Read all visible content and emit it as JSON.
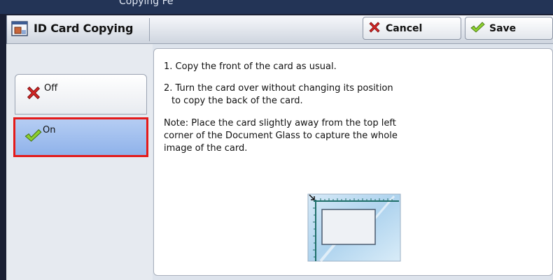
{
  "header_strip": {
    "text": "Copying Fe"
  },
  "window": {
    "title": "ID Card Copying",
    "cancel_label": "Cancel",
    "save_label": "Save"
  },
  "options": {
    "off_label": "Off",
    "on_label": "On",
    "selected": "On"
  },
  "instructions": {
    "step1": "1. Copy the front of the card as usual.",
    "step2_line1": "2. Turn the card over without changing its position",
    "step2_line2": "to copy the back of the card.",
    "note_line1": "Note: Place the card slightly away from the top left",
    "note_line2": "corner of the Document Glass to capture the whole",
    "note_line3": "image of the card."
  },
  "colors": {
    "selection_border": "#e41a1a",
    "selected_fill": "#a6c2f0",
    "cancel_icon": "#d42424",
    "save_icon": "#8ccf2f"
  },
  "icons": {
    "app": "id-card-copy-icon",
    "cancel": "red-x-icon",
    "save": "green-check-icon"
  }
}
